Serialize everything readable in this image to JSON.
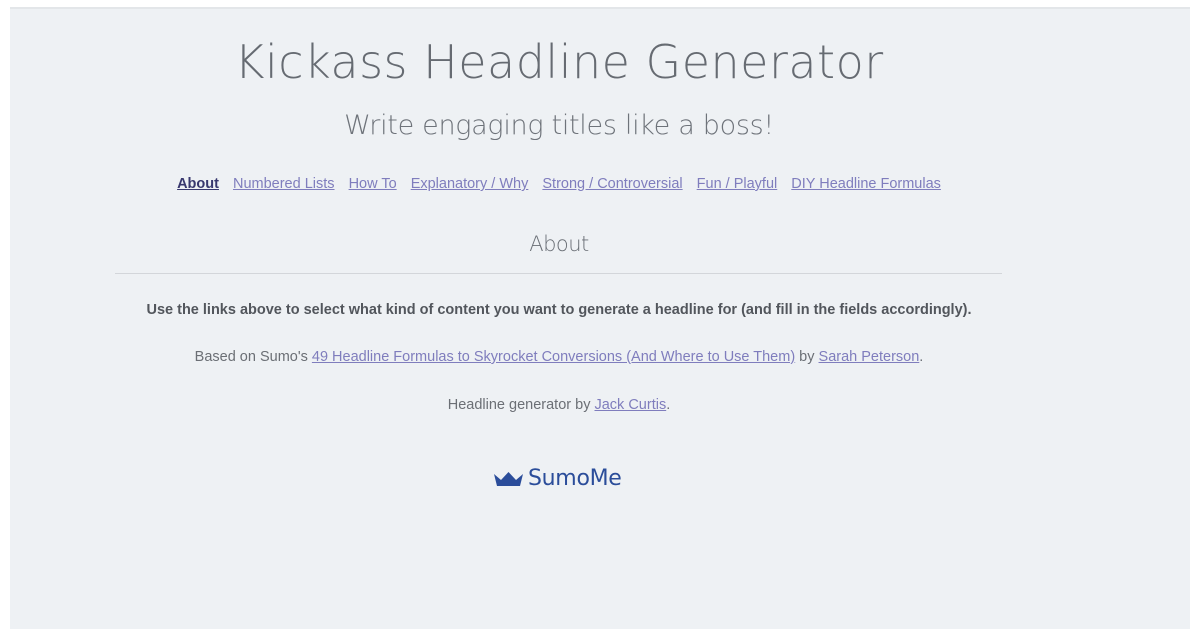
{
  "header": {
    "title": "Kickass Headline Generator",
    "subtitle": "Write engaging titles like a boss!"
  },
  "nav": {
    "items": [
      {
        "label": "About",
        "active": true
      },
      {
        "label": "Numbered Lists",
        "active": false
      },
      {
        "label": "How To",
        "active": false
      },
      {
        "label": "Explanatory / Why",
        "active": false
      },
      {
        "label": "Strong / Controversial",
        "active": false
      },
      {
        "label": "Fun / Playful",
        "active": false
      },
      {
        "label": "DIY Headline Formulas",
        "active": false
      }
    ]
  },
  "about": {
    "heading": "About",
    "lead": "Use the links above to select what kind of content you want to generate a headline for (and fill in the fields accordingly).",
    "credit_prefix": "Based on Sumo's ",
    "credit_link": "49 Headline Formulas to Skyrocket Conversions (And Where to Use Them)",
    "credit_by": " by ",
    "credit_author": "Sarah Peterson",
    "credit_suffix": ".",
    "generator_prefix": "Headline generator by ",
    "generator_author": "Jack Curtis",
    "generator_suffix": "."
  },
  "footer": {
    "logo_icon": "crown-icon",
    "logo_text": "SumoMe"
  },
  "colors": {
    "background": "#eef1f4",
    "link": "#7f7dbd",
    "link_active": "#38386e",
    "brand": "#2b4d9a"
  }
}
